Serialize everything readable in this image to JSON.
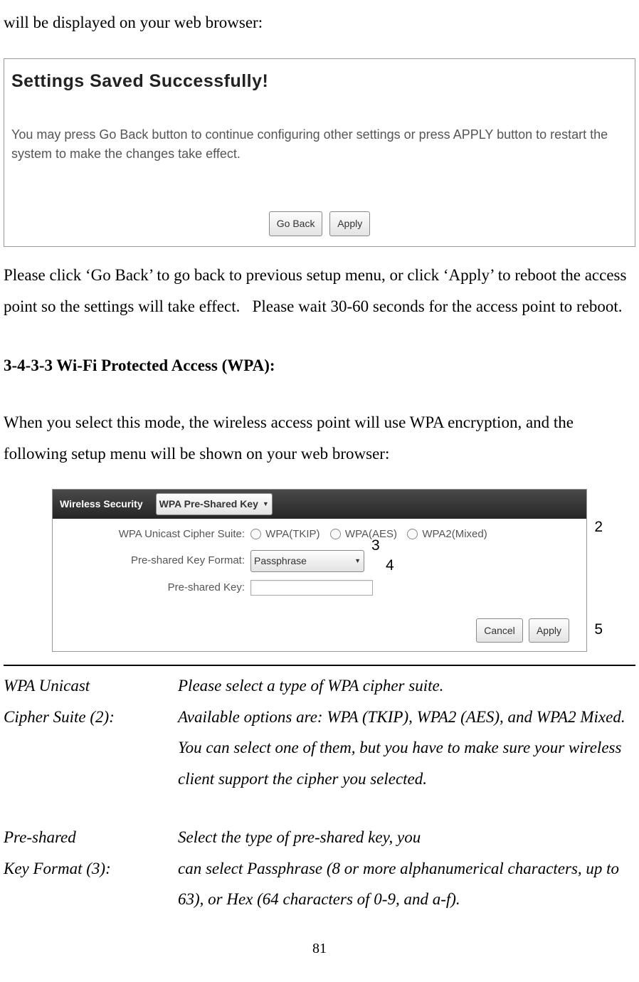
{
  "intro": "will be displayed on your web browser:",
  "saved": {
    "title": "Settings Saved Successfully!",
    "desc": "You may press Go Back button to continue configuring other settings or press APPLY button to restart the system to make the changes take effect.",
    "goBack": "Go Back",
    "apply": "Apply"
  },
  "para1": "Please click ‘Go Back’ to go back to previous setup menu, or click ‘Apply’ to reboot the access point so the settings will take effect.   Please wait 30-60 seconds for the access point to reboot.",
  "sectionTitle": "3-4-3-3 Wi-Fi Protected Access (WPA):",
  "para2": "When you select this mode, the wireless access point will use WPA encryption, and the following setup menu will be shown on your web browser:",
  "wpa": {
    "headerLabel": "Wireless Security",
    "headerSelect": "WPA Pre-Shared Key",
    "cipherLabel": "WPA Unicast Cipher Suite:",
    "opt1": "WPA(TKIP)",
    "opt2": "WPA(AES)",
    "opt3": "WPA2(Mixed)",
    "formatLabel": "Pre-shared Key Format:",
    "formatSelect": "Passphrase",
    "keyLabel": "Pre-shared Key:",
    "cancel": "Cancel",
    "apply": "Apply",
    "callout2": "2",
    "callout3": "3",
    "callout4": "4",
    "callout5": "5"
  },
  "desc": {
    "term1a": "WPA Unicast",
    "term1b": "Cipher Suite (2):",
    "def1a": "Please select a type of WPA cipher suite.",
    "def1b": "Available options are: WPA (TKIP), WPA2 (AES), and WPA2 Mixed. You can select one of them, but you have to make sure your wireless client support the cipher you selected.",
    "term2a": "Pre-shared",
    "term2b": "Key Format (3):",
    "def2a": "Select the type of pre-shared key, you",
    "def2b": "can select Passphrase (8 or more alphanumerical characters, up to 63), or Hex (64 characters of 0-9, and a-f)."
  },
  "pageNum": "81"
}
